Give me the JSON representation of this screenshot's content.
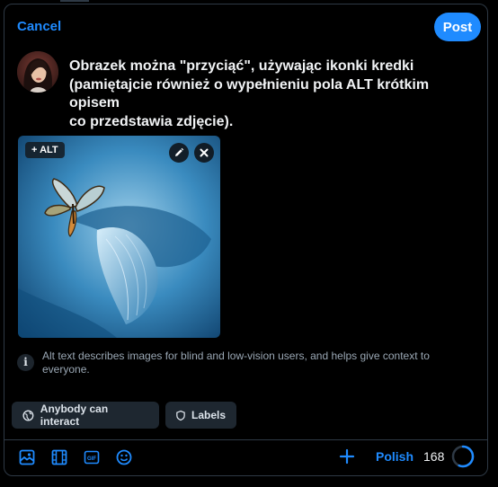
{
  "header": {
    "cancel_label": "Cancel",
    "post_label": "Post"
  },
  "post": {
    "text": "Obrazek można \"przyciąć\", używając ikonki kredki\n(pamiętajcie również o wypełnieniu pola ALT krótkim opisem\nco przedstawia zdjęcie)."
  },
  "image": {
    "alt_label": "+ ALT",
    "edit_icon": "pencil-icon",
    "remove_icon": "close-icon"
  },
  "info": {
    "icon_glyph": "i",
    "text": "Alt text describes images for blind and low-vision users, and helps give context to everyone."
  },
  "chips": {
    "interact_label": "Anybody can interact",
    "labels_label": "Labels"
  },
  "toolbar": {
    "icons": [
      "image-icon",
      "film-icon",
      "gif-icon",
      "emoji-icon",
      "plus-icon"
    ],
    "gif_text": "GIF",
    "polish_label": "Polish",
    "char_count": "168",
    "char_progress": 0.56
  },
  "colors": {
    "accent": "#1f8bff",
    "background": "#000000",
    "chip_bg": "#1e2730",
    "border": "#2e3945"
  }
}
